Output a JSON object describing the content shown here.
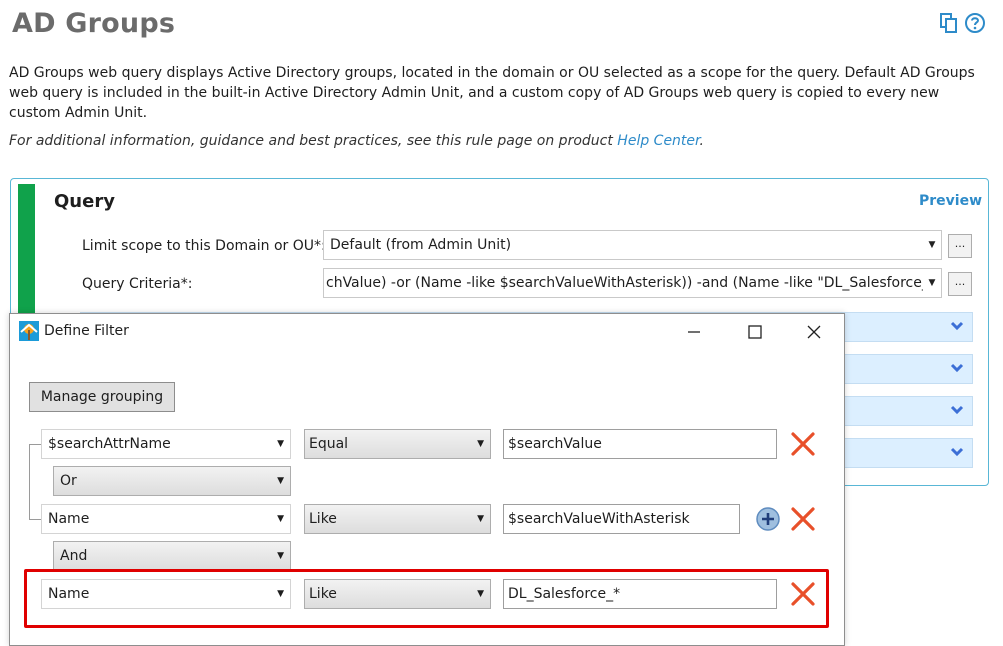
{
  "page": {
    "title": "AD Groups",
    "description": "AD Groups web query displays Active Directory groups, located in the domain or OU selected as a scope for the query. Default AD Groups web query is included in the built-in Active Directory Admin Unit, and a custom copy of AD Groups web query is copied to every new custom Admin Unit.",
    "help_text": "For additional information, guidance and best practices, see this rule page on product ",
    "help_link": "Help Center",
    "help_end": "."
  },
  "query": {
    "title": "Query",
    "preview": "Preview",
    "scope_label": "Limit scope to this Domain or OU*:",
    "scope_value": "Default (from Admin Unit)",
    "criteria_label": "Query Criteria*:",
    "criteria_value": "chValue) -or (Name -like $searchValueWithAsterisk)) -and (Name -like \"DL_Salesforce_*\")}",
    "dots": "..."
  },
  "dialog": {
    "title": "Define Filter",
    "manage_grouping": "Manage grouping",
    "rows": [
      {
        "attr": "$searchAttrName",
        "op": "Equal",
        "value": "$searchValue"
      },
      {
        "attr": "Name",
        "op": "Like",
        "value": "$searchValueWithAsterisk"
      },
      {
        "attr": "Name",
        "op": "Like",
        "value": "DL_Salesforce_*"
      }
    ],
    "connectors": [
      "Or",
      "And"
    ]
  },
  "colors": {
    "accent": "#2e8bc9",
    "green": "#10a24b",
    "highlight": "#e00000",
    "remove": "#e8502a"
  }
}
